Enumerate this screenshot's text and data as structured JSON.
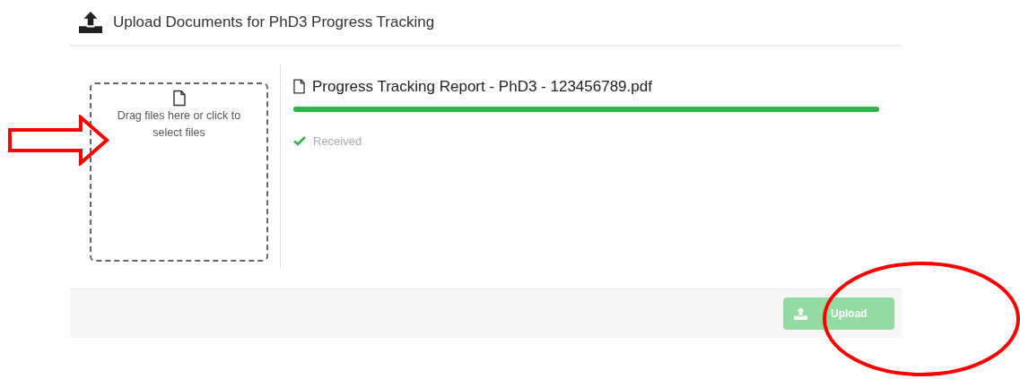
{
  "dialog": {
    "title": "Upload Documents for PhD3 Progress Tracking"
  },
  "dropzone": {
    "text": "Drag files here or click to select files"
  },
  "files": [
    {
      "name": "Progress Tracking Report - PhD3 - 123456789.pdf",
      "level": 1,
      "status": "Received",
      "received": true
    }
  ],
  "upload_button": {
    "label": "Upload",
    "disabled": true
  }
}
